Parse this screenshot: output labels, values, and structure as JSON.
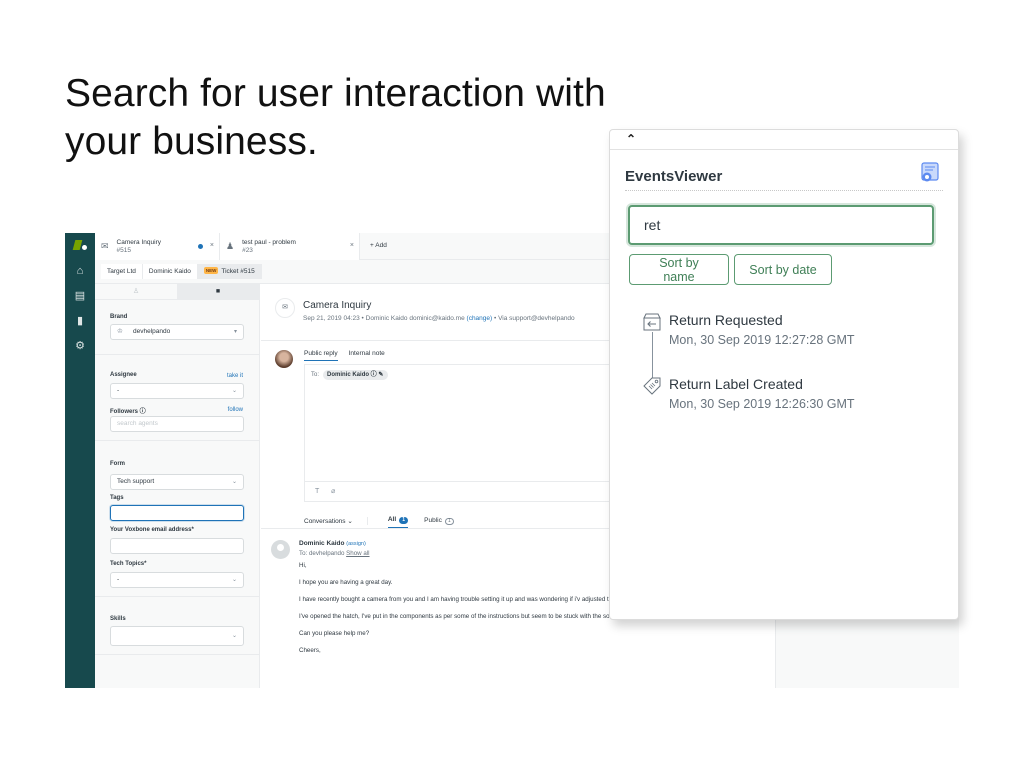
{
  "headline": {
    "line1": "Search for user interaction with",
    "line2": "your business."
  },
  "zendesk": {
    "tabs": [
      {
        "title": "Camera Inquiry",
        "sub": "#515",
        "icon": "envelope-icon",
        "unread": true
      },
      {
        "title": "test paul - problem",
        "sub": "#23",
        "icon": "user-icon",
        "unread": false
      }
    ],
    "add_tab_label": "+ Add",
    "breadcrumbs": [
      "Target Ltd",
      "Dominic Kaido",
      "Ticket #515"
    ],
    "new_badge": "NEW",
    "sidebar": {
      "brand_label": "Brand",
      "brand_value": "devhelpando",
      "assignee_label": "Assignee",
      "assignee_link": "take it",
      "assignee_value": "-",
      "followers_label": "Followers ⓘ",
      "followers_link": "follow",
      "followers_placeholder": "search agents",
      "form_label": "Form",
      "form_value": "Tech support",
      "tags_label": "Tags",
      "tags_value": "",
      "email_label": "Your Voxbone email address*",
      "email_value": "",
      "topics_label": "Tech Topics*",
      "topics_value": "-",
      "skills_label": "Skills",
      "skills_value": ""
    },
    "ticket": {
      "title": "Camera Inquiry",
      "meta_prefix": "Sep 21, 2019 04:23 • Dominic Kaido   dominic@kaido.me ",
      "meta_change": "(change)",
      "meta_suffix": " • Via support@devhelpando",
      "reply_tabs": [
        "Public reply",
        "Internal note"
      ],
      "to_label": "To:",
      "to_chip": "Dominic Kaido ⓘ ✎",
      "toolbar_text": "T",
      "toolbar_attach": "⌀",
      "conversations_label": "Conversations ⌄",
      "filter_all": "All",
      "filter_all_count": "1",
      "filter_public": "Public",
      "filter_public_count": "1"
    },
    "message": {
      "sender": "Dominic Kaido",
      "assign": "(assign)",
      "to_prefix": "To: devhelpando ",
      "show_all": "Show all",
      "paragraphs": [
        "Hi,",
        "I hope you are having a great day.",
        "I have recently bought a camera from you and I am having trouble setting it up and was wondering if i'v adjusted to it.",
        "I've opened the hatch, I've put in the components as per some of the instructions but seem to be stuck with the software.",
        "Can you please help me?",
        "Cheers,"
      ]
    }
  },
  "events_viewer": {
    "collapse_icon": "⌃",
    "title": "EventsViewer",
    "search_value": "ret",
    "sort_by_name": "Sort by name",
    "sort_by_date": "Sort by date",
    "accent_color": "#5c9b72",
    "events": [
      {
        "name": "Return Requested",
        "time": "Mon, 30 Sep 2019 12:27:28 GMT",
        "icon": "return-box-icon"
      },
      {
        "name": "Return Label Created",
        "time": "Mon, 30 Sep 2019 12:26:30 GMT",
        "icon": "label-tag-icon"
      }
    ]
  }
}
